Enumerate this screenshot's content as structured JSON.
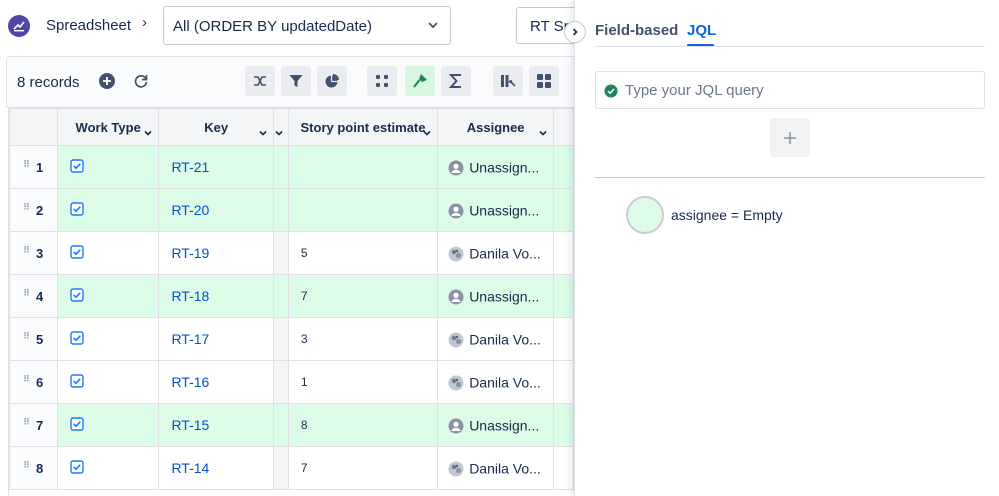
{
  "app": {
    "title": "Spreadsheet",
    "logo_icon": "spreadsheet-app-logo",
    "accent": "#5046a8"
  },
  "view_select": {
    "value": "All (ORDER BY updatedDate)"
  },
  "rt_button": {
    "label": "RT Sp"
  },
  "toolbar": {
    "records": "8 records",
    "icons": [
      "add-circle-icon",
      "refresh-icon",
      "shuffle-icon",
      "filter-icon",
      "pie-chart-icon",
      "group-icon",
      "paint-icon",
      "sum-icon",
      "columns-icon",
      "grid-icon"
    ]
  },
  "table": {
    "columns": [
      "Work Type",
      "Key",
      "Story point estimate",
      "Assignee"
    ],
    "rows": [
      {
        "n": "1",
        "key": "RT-21",
        "sp": "",
        "assignee": "Unassign...",
        "highlight": true,
        "avatar": "unassigned"
      },
      {
        "n": "2",
        "key": "RT-20",
        "sp": "",
        "assignee": "Unassign...",
        "highlight": true,
        "avatar": "unassigned"
      },
      {
        "n": "3",
        "key": "RT-19",
        "sp": "5",
        "assignee": "Danila Vo...",
        "highlight": false,
        "avatar": "user"
      },
      {
        "n": "4",
        "key": "RT-18",
        "sp": "7",
        "assignee": "Unassign...",
        "highlight": true,
        "avatar": "unassigned"
      },
      {
        "n": "5",
        "key": "RT-17",
        "sp": "3",
        "assignee": "Danila Vo...",
        "highlight": false,
        "avatar": "user"
      },
      {
        "n": "6",
        "key": "RT-16",
        "sp": "1",
        "assignee": "Danila Vo...",
        "highlight": false,
        "avatar": "user"
      },
      {
        "n": "7",
        "key": "RT-15",
        "sp": "8",
        "assignee": "Unassign...",
        "highlight": true,
        "avatar": "unassigned"
      },
      {
        "n": "8",
        "key": "RT-14",
        "sp": "7",
        "assignee": "Danila Vo...",
        "highlight": false,
        "avatar": "user"
      }
    ],
    "highlight_color": "#dcfce7"
  },
  "panel": {
    "tabs": [
      {
        "label": "Field-based",
        "active": false
      },
      {
        "label": "JQL",
        "active": true
      }
    ],
    "jql_placeholder": "Type your JQL query",
    "filter_rule": "assignee = Empty",
    "active_tab_color": "#0c66e4"
  }
}
